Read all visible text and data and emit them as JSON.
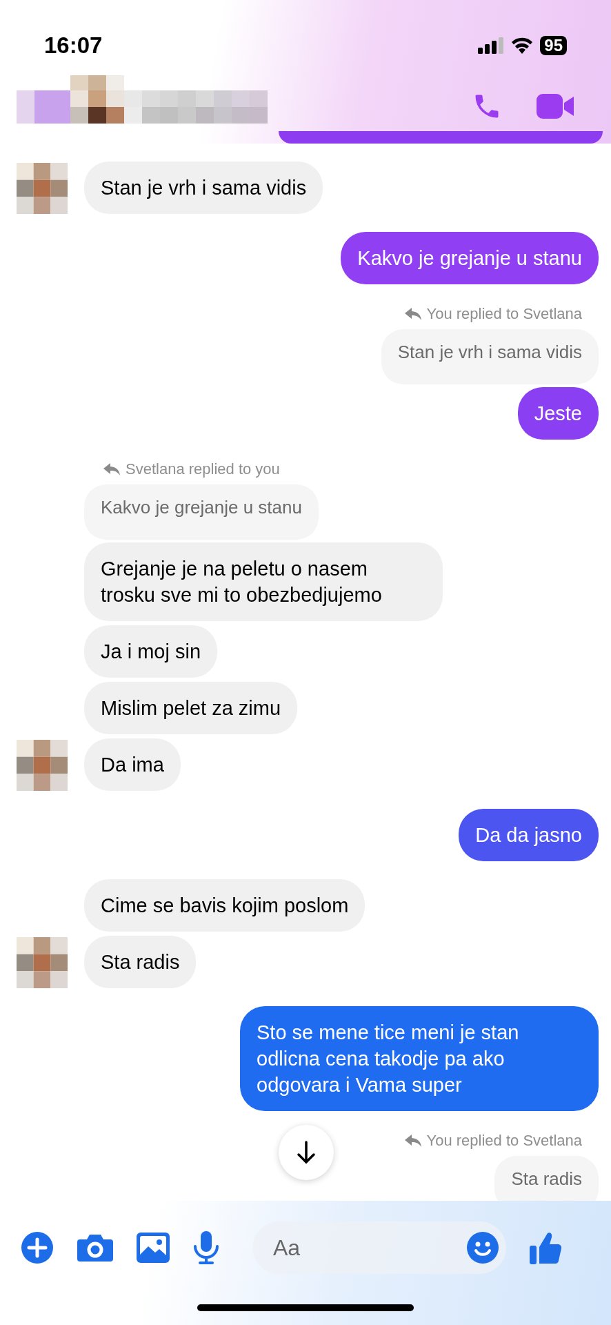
{
  "status_bar": {
    "time": "16:07",
    "battery": "95"
  },
  "header": {
    "kind": "pixelated_contact"
  },
  "messages": [
    {
      "kind": "out_cut",
      "color": "#8e3cf0"
    },
    {
      "kind": "in_text",
      "text": "Stan je vrh i sama vidis",
      "avatar": true
    },
    {
      "kind": "out_text",
      "text": "Kakvo je grejanje u stanu",
      "color": "#9040f2"
    },
    {
      "kind": "out_reply_note",
      "text": "You replied to Svetlana"
    },
    {
      "kind": "out_quote",
      "text": "Stan je vrh i sama vidis"
    },
    {
      "kind": "out_text",
      "text": "Jeste",
      "color": "#8a3ff3"
    },
    {
      "kind": "in_reply_note",
      "text": "Svetlana replied to you"
    },
    {
      "kind": "in_quote",
      "text": "Kakvo je grejanje u stanu"
    },
    {
      "kind": "in_text",
      "text": "Grejanje je na peletu o nasem trosku sve mi to obezbedjujemo",
      "avatar": false
    },
    {
      "kind": "in_text",
      "text": "Ja i moj sin",
      "avatar": false
    },
    {
      "kind": "in_text",
      "text": "Mislim pelet za zimu",
      "avatar": false
    },
    {
      "kind": "in_text",
      "text": "Da ima",
      "avatar": true
    },
    {
      "kind": "out_text",
      "text": "Da da jasno",
      "color": "#4c55f0"
    },
    {
      "kind": "in_text",
      "text": "Cime se bavis kojim poslom",
      "avatar": false
    },
    {
      "kind": "in_text",
      "text": "Sta radis",
      "avatar": true
    },
    {
      "kind": "out_text",
      "text": "Sto se mene tice meni je stan odlicna cena takodje pa ako odgovara i Vama super",
      "color": "#1f6cf0"
    },
    {
      "kind": "out_reply_note",
      "text": "You replied to Svetlana"
    },
    {
      "kind": "out_quote",
      "text": "Sta radis"
    }
  ],
  "composer": {
    "placeholder": "Aa"
  }
}
